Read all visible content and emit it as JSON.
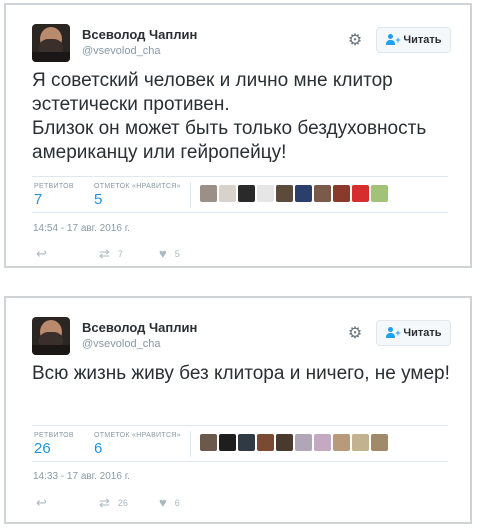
{
  "tweets": [
    {
      "author": {
        "name": "Всеволод Чаплин",
        "handle": "@vsevolod_cha"
      },
      "follow_label": "Читать",
      "text": "Я советский человек и лично мне клитор эстетически противен.\nБлизок он может быть только бездуховность американцу или гейропейцу!",
      "retweets_label": "РЕТВИТОВ",
      "retweets": "7",
      "likes_label": "ОТМЕТОК «НРАВИТСЯ»",
      "likes": "5",
      "timestamp": "14:54 - 17 авг. 2016 г.",
      "action_retweets": "7",
      "action_likes": "5",
      "likers": [
        "#9c8f86",
        "#d9d2cb",
        "#2a2a2a",
        "#e6e6e6",
        "#5c4a3a",
        "#2c3e6b",
        "#7a5a48",
        "#8a3a2a",
        "#d62e2e",
        "#a2c27a"
      ]
    },
    {
      "author": {
        "name": "Всеволод Чаплин",
        "handle": "@vsevolod_cha"
      },
      "follow_label": "Читать",
      "text": "Всю жизнь живу без клитора и ничего, не умер!",
      "retweets_label": "РЕТВИТОВ",
      "retweets": "26",
      "likes_label": "ОТМЕТОК «НРАВИТСЯ»",
      "likes": "6",
      "timestamp": "14:33 - 17 авг. 2016 г.",
      "action_retweets": "26",
      "action_likes": "6",
      "likers": [
        "#6b5a4c",
        "#1e1e1e",
        "#2f3a44",
        "#7a4a32",
        "#4a3a2e",
        "#b0a6b8",
        "#c5a9c2",
        "#b89a7a",
        "#c2b28f",
        "#a08a6a"
      ]
    }
  ]
}
